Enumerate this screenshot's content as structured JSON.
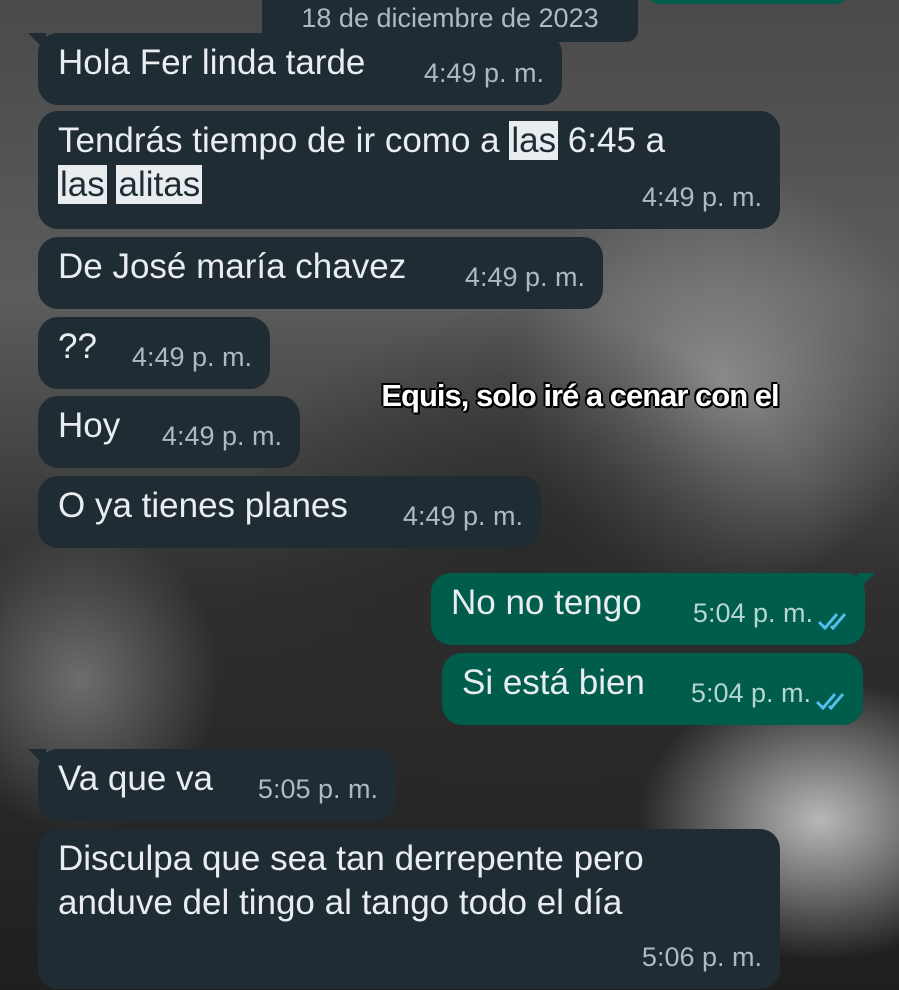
{
  "date_chip": "18 de diciembre de 2023",
  "overlay_caption": "Equis, solo iré a cenar con el",
  "messages": [
    {
      "dir": "in",
      "text": "Hola Fer linda tarde",
      "time": "4:49 p. m."
    },
    {
      "dir": "in",
      "text_parts": [
        "Tendrás tiempo de ir como a ",
        "las",
        " 6:45 a ",
        "las",
        " ",
        "alitas"
      ],
      "time": "4:49 p. m."
    },
    {
      "dir": "in",
      "text": "De José maría chavez",
      "time": "4:49 p. m."
    },
    {
      "dir": "in",
      "text": "??",
      "time": "4:49 p. m."
    },
    {
      "dir": "in",
      "text": "Hoy",
      "time": "4:49 p. m."
    },
    {
      "dir": "in",
      "text": "O ya tienes planes",
      "time": "4:49 p. m."
    },
    {
      "dir": "out",
      "text": "No no tengo",
      "time": "5:04 p. m.",
      "status": "read"
    },
    {
      "dir": "out",
      "text": "Si está bien",
      "time": "5:04 p. m.",
      "status": "read"
    },
    {
      "dir": "in",
      "text": "Va que va",
      "time": "5:05 p. m."
    },
    {
      "dir": "in",
      "text": "Disculpa que sea tan derrepente pero anduve del tingo al tango todo el día",
      "time": "5:06 p. m."
    }
  ],
  "colors": {
    "incoming_bubble": "#1f2c34",
    "outgoing_bubble": "#005c4b",
    "read_ticks": "#53bdeb",
    "text": "#e9edef"
  },
  "icons": {
    "read_receipt": "double-check-icon"
  }
}
